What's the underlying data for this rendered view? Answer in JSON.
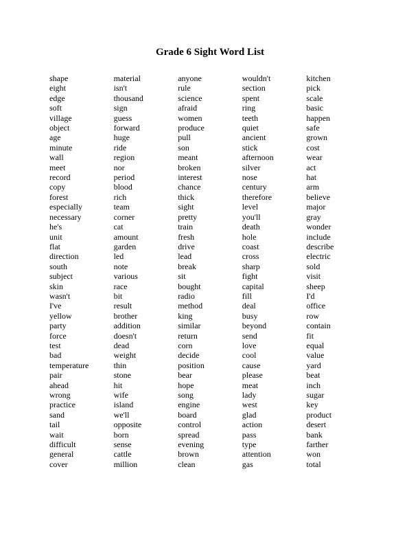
{
  "title": "Grade 6 Sight Word List",
  "columns": [
    [
      "shape",
      "eight",
      "edge",
      "soft",
      "village",
      "object",
      "age",
      "minute",
      "wall",
      "meet",
      "record",
      "copy",
      "forest",
      "especially",
      "necessary",
      "he's",
      "unit",
      "flat",
      "direction",
      "south",
      "subject",
      "skin",
      "wasn't",
      "I've",
      "yellow",
      "party",
      "force",
      "test",
      "bad",
      "temperature",
      "pair",
      "ahead",
      "wrong",
      "practice",
      "sand",
      "tail",
      "wait",
      "difficult",
      "general",
      "cover"
    ],
    [
      "material",
      "isn't",
      "thousand",
      "sign",
      "guess",
      "forward",
      "huge",
      "ride",
      "region",
      "nor",
      "period",
      "blood",
      "rich",
      "team",
      "corner",
      "cat",
      "amount",
      "garden",
      "led",
      "note",
      "various",
      "race",
      "bit",
      "result",
      "brother",
      "addition",
      "doesn't",
      "dead",
      "weight",
      "thin",
      "stone",
      "hit",
      "wife",
      "island",
      "we'll",
      "opposite",
      "born",
      "sense",
      "cattle",
      "million"
    ],
    [
      "anyone",
      "rule",
      "science",
      "afraid",
      "women",
      "produce",
      "pull",
      "son",
      "meant",
      "broken",
      "interest",
      "chance",
      "thick",
      "sight",
      "pretty",
      "train",
      "fresh",
      "drive",
      "lead",
      "break",
      "sit",
      "bought",
      "radio",
      "method",
      "king",
      "similar",
      "return",
      "corn",
      "decide",
      "position",
      "bear",
      "hope",
      "song",
      "engine",
      "board",
      "control",
      "spread",
      "evening",
      "brown",
      "clean"
    ],
    [
      "wouldn't",
      "section",
      "spent",
      "ring",
      "teeth",
      "quiet",
      "ancient",
      "stick",
      "afternoon",
      "silver",
      "nose",
      "century",
      "therefore",
      "level",
      "you'll",
      "death",
      "hole",
      "coast",
      "cross",
      "sharp",
      "fight",
      "capital",
      "fill",
      "deal",
      "busy",
      "beyond",
      "send",
      "love",
      "cool",
      "cause",
      "please",
      "meat",
      "lady",
      "west",
      "glad",
      "action",
      "pass",
      "type",
      "attention",
      "gas"
    ],
    [
      "kitchen",
      "pick",
      "scale",
      "basic",
      "happen",
      "safe",
      "grown",
      "cost",
      "wear",
      "act",
      "hat",
      "arm",
      "believe",
      "major",
      "gray",
      "wonder",
      "include",
      "describe",
      "electric",
      "sold",
      "visit",
      "sheep",
      "I'd",
      "office",
      "row",
      "contain",
      "fit",
      "equal",
      "value",
      "yard",
      "beat",
      "inch",
      "sugar",
      "key",
      "product",
      "desert",
      "bank",
      "farther",
      "won",
      "total"
    ]
  ]
}
